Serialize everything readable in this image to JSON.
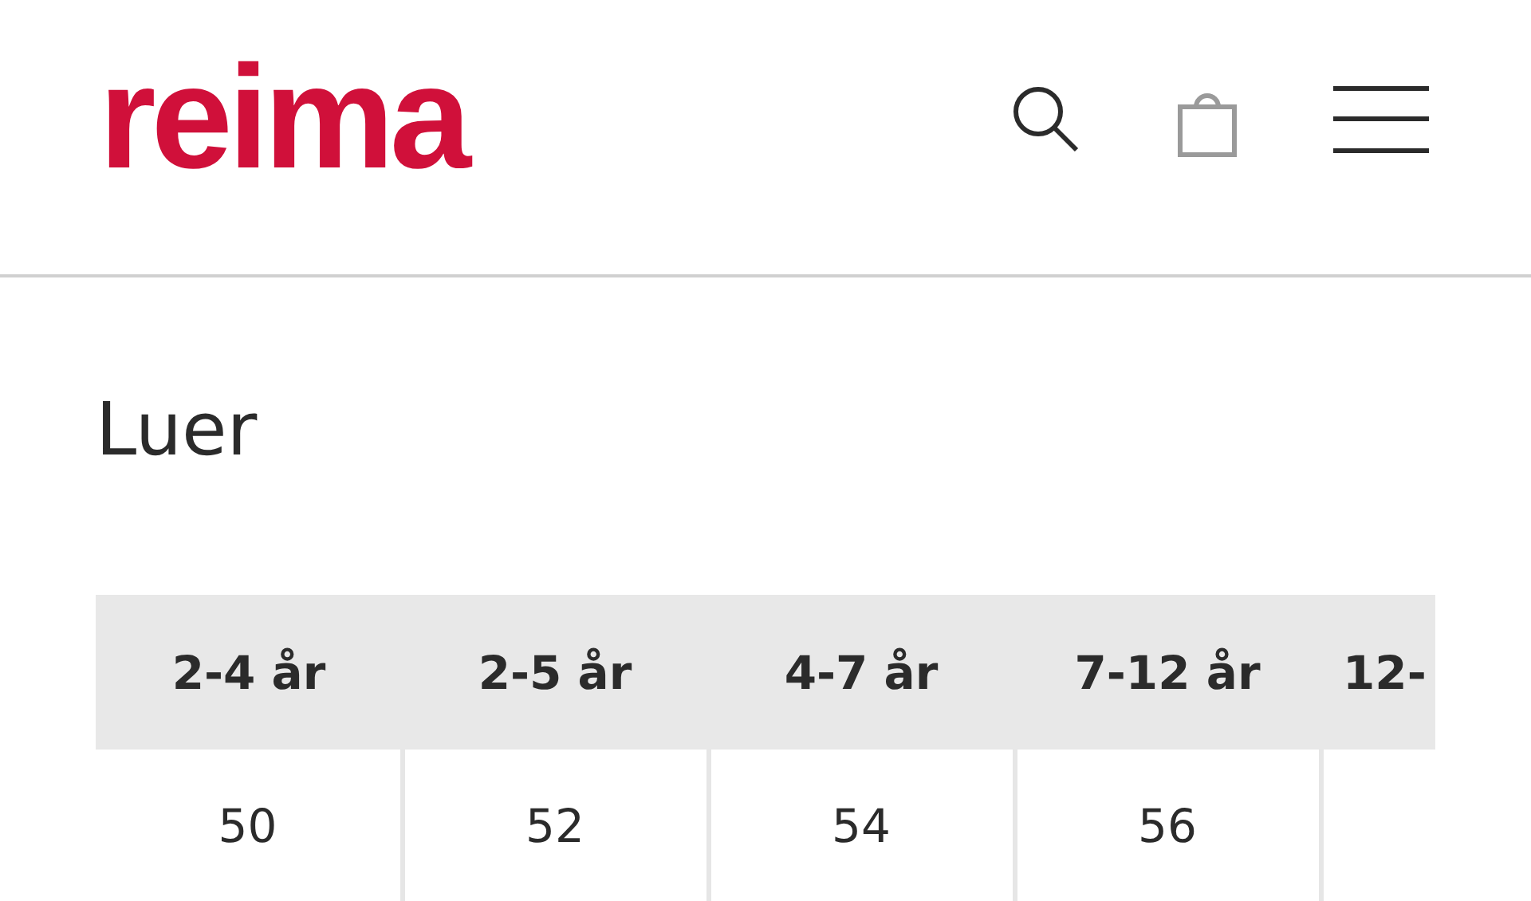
{
  "header": {
    "logo": "reima"
  },
  "title": "Luer",
  "table": {
    "columns": [
      "2-4 år",
      "2-5 år",
      "4-7 år",
      "7-12 år",
      "12-"
    ],
    "rows": [
      {
        "cells": [
          "50",
          "52",
          "54",
          "56"
        ]
      }
    ]
  }
}
